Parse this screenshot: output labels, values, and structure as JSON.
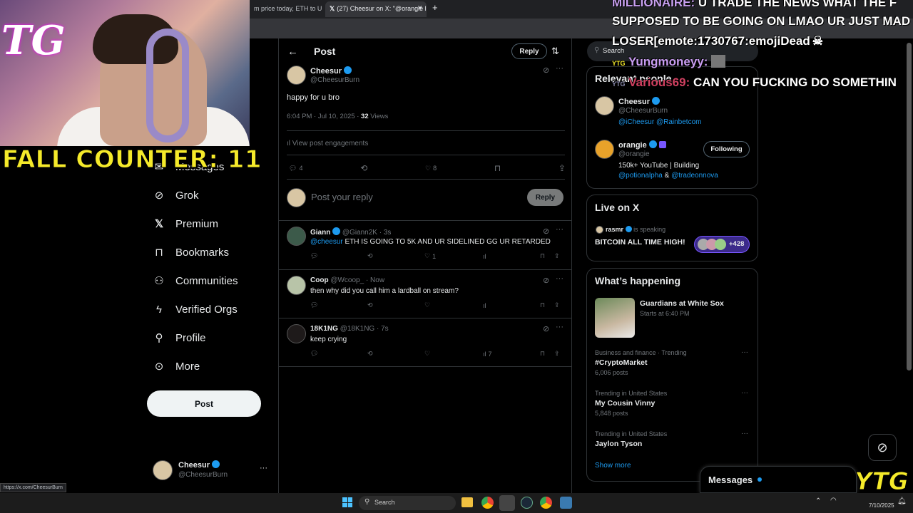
{
  "browser": {
    "tabs": [
      {
        "label": "m price today, ETH to U"
      },
      {
        "label": "(27) Cheesur on X: \"@orangie l"
      }
    ]
  },
  "overlay": {
    "logo_text": "TG",
    "fall_counter": "FALL COUNTER: 11",
    "chat": [
      {
        "user": "MILLIONAIRE:",
        "message": "U TRADE THE NEWS WHAT THE F"
      },
      {
        "user": "",
        "message": "SUPPOSED TO BE GOING ON LMAO UR JUST MAD"
      },
      {
        "user": "",
        "message": "LOSER[emote:1730767:emojiDead"
      },
      {
        "user": "Yungmoneyy:",
        "message": ""
      },
      {
        "user": "Various69:",
        "message": "CAN YOU FUCKING DO SOMETHIN"
      }
    ],
    "corner_logo": "YTG"
  },
  "nav": {
    "items": [
      {
        "label": "Messages",
        "icon": "mail-icon"
      },
      {
        "label": "Grok",
        "icon": "grok-icon"
      },
      {
        "label": "Premium",
        "icon": "x-logo-icon"
      },
      {
        "label": "Bookmarks",
        "icon": "bookmark-icon"
      },
      {
        "label": "Communities",
        "icon": "communities-icon"
      },
      {
        "label": "Verified Orgs",
        "icon": "lightning-icon"
      },
      {
        "label": "Profile",
        "icon": "person-icon"
      },
      {
        "label": "More",
        "icon": "more-circle-icon"
      }
    ],
    "post_label": "Post",
    "account": {
      "name": "Cheesur",
      "handle": "@CheesurBurn"
    }
  },
  "status_url": "https://x.com/CheesurBurn",
  "header": {
    "title": "Post",
    "reply_label": "Reply"
  },
  "post": {
    "author": "Cheesur",
    "handle": "@CheesurBurn",
    "text": "happy for u bro",
    "timestamp": "6:04 PM · Jul 10, 2025 · ",
    "views_count": "32",
    "views_label": " Views",
    "engagements_label": "View post engagements",
    "replies": "4",
    "likes": "8"
  },
  "composer": {
    "placeholder": "Post your reply",
    "button": "Reply"
  },
  "replies": [
    {
      "name": "Giann",
      "handle": "@Giann2K · 3s",
      "mention": "@cheesur",
      "text": " ETH IS GOING TO 5K AND UR SIDELINED GG UR RETARDED",
      "likes": "1",
      "views": ""
    },
    {
      "name": "Coop",
      "handle": "@Wcoop_ · Now",
      "mention": "",
      "text": "then why did you call him a lardball on stream?",
      "likes": "",
      "views": ""
    },
    {
      "name": "18K1NG",
      "handle": "@18K1NG · 7s",
      "mention": "",
      "text": "keep crying",
      "likes": "",
      "views": "7"
    }
  ],
  "sidebar": {
    "search_placeholder": "Search",
    "relevant_title": "Relevant people",
    "people": [
      {
        "name": "Cheesur",
        "handle": "@CheesurBurn",
        "bio_links": "@iCheesur @Rainbetcom",
        "bio": "",
        "button": ""
      },
      {
        "name": "orangie",
        "handle": "@orangie",
        "bio": "150k+ YouTube | Building",
        "bio_links": "@potionalpha",
        "bio_and": " & ",
        "bio_links2": "@tradeonnova",
        "button": "Following"
      }
    ],
    "live": {
      "title": "Live on X",
      "host": "rasmr",
      "status": "is speaking",
      "space_title": "BITCOIN ALL TIME HIGH!",
      "listeners": "+428"
    },
    "happening": {
      "title": "What’s happening",
      "event": {
        "title": "Guardians at White Sox",
        "subtitle": "Starts at 6:40 PM"
      },
      "trends": [
        {
          "context": "Business and finance · Trending",
          "name": "#CryptoMarket",
          "count": "6,006 posts"
        },
        {
          "context": "Trending in United States",
          "name": "My Cousin Vinny",
          "count": "5,848 posts"
        },
        {
          "context": "Trending in United States",
          "name": "Jaylon Tyson",
          "count": ""
        }
      ],
      "show_more": "Show more"
    },
    "messages_label": "Messages"
  },
  "taskbar": {
    "search_label": "Search",
    "date": "7/10/2025"
  }
}
